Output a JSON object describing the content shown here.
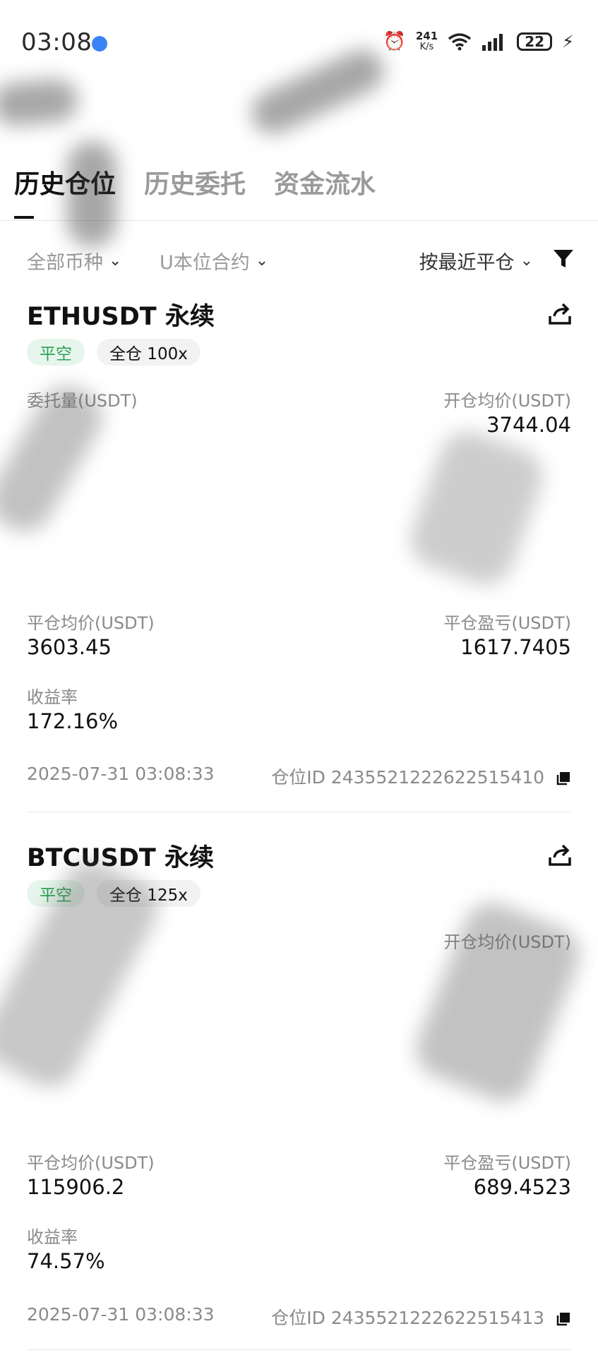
{
  "status_bar": {
    "time": "03:08",
    "net_speed_value": "241",
    "net_speed_unit": "K/s",
    "battery": "22"
  },
  "tabs": [
    {
      "label": "历史仓位"
    },
    {
      "label": "历史委托"
    },
    {
      "label": "资金流水"
    }
  ],
  "filters": {
    "coin": "全部币种",
    "contract": "U本位合约",
    "sort": "按最近平仓"
  },
  "positions": [
    {
      "symbol": "ETHUSDT 永续",
      "side": "平空",
      "margin": "全仓 100x",
      "open_qty_label": "委托量(USDT)",
      "open_avg_label": "开仓均价(USDT)",
      "open_avg_value": "3744.04",
      "close_avg_label": "平仓均价(USDT)",
      "close_avg_value": "3603.45",
      "pnl_label": "平仓盈亏(USDT)",
      "pnl_value": "1617.7405",
      "roi_label": "收益率",
      "roi_value": "172.16%",
      "time": "2025-07-31 03:08:33",
      "position_id": "仓位ID 2435521222622515410"
    },
    {
      "symbol": "BTCUSDT 永续",
      "side": "平空",
      "margin": "全仓 125x",
      "open_avg_label": "开仓均价(USDT)",
      "close_avg_label": "平仓均价(USDT)",
      "close_avg_value": "115906.2",
      "pnl_label": "平仓盈亏(USDT)",
      "pnl_value": "689.4523",
      "roi_label": "收益率",
      "roi_value": "74.57%",
      "time": "2025-07-31 03:08:33",
      "position_id": "仓位ID 2435521222622515413"
    }
  ],
  "colors": {
    "accent_green": "#2aa254",
    "tag_green_bg": "#e7f6ec",
    "muted_text": "#8a8a8a"
  }
}
